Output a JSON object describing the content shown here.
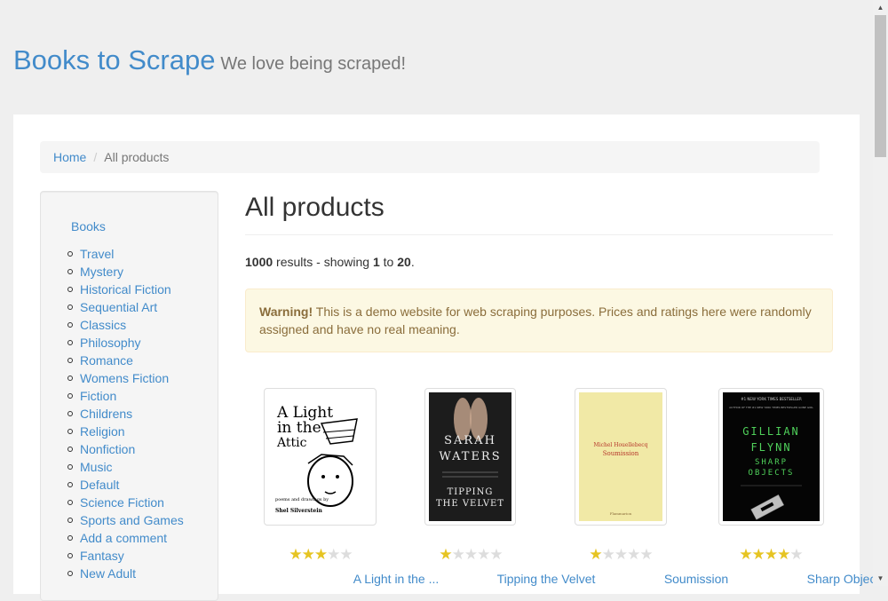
{
  "brand": {
    "title": "Books to Scrape",
    "tagline": "We love being scraped!"
  },
  "breadcrumb": {
    "home": "Home",
    "sep": "/",
    "current": "All products"
  },
  "sidebar": {
    "heading": "Books",
    "items": [
      "Travel",
      "Mystery",
      "Historical Fiction",
      "Sequential Art",
      "Classics",
      "Philosophy",
      "Romance",
      "Womens Fiction",
      "Fiction",
      "Childrens",
      "Religion",
      "Nonfiction",
      "Music",
      "Default",
      "Science Fiction",
      "Sports and Games",
      "Add a comment",
      "Fantasy",
      "New Adult"
    ]
  },
  "main": {
    "title": "All products",
    "results": {
      "total": "1000",
      "mid": " results - showing ",
      "from": "1",
      "to_word": " to ",
      "to": "20",
      "end": "."
    },
    "alert": {
      "strong": "Warning!",
      "text": " This is a demo website for web scraping purposes. Prices and ratings here were randomly assigned and have no real meaning."
    }
  },
  "products": [
    {
      "title": "A Light in the ...",
      "rating": 3,
      "cover_text": [
        "A Light",
        "in the",
        "Attic"
      ],
      "cover_small": "poems and drawings by",
      "cover_author": "Shel Silverstein"
    },
    {
      "title": "Tipping the Velvet",
      "rating": 1,
      "cover_text": [
        "SARAH",
        "WATERS"
      ],
      "cover_sub": [
        "TIPPING",
        "THE VELVET"
      ]
    },
    {
      "title": "Soumission",
      "rating": 1,
      "cover_author": "Michel Houellebecq",
      "cover_title": "Soumission",
      "cover_pub": "Flammarion"
    },
    {
      "title": "Sharp Objects",
      "rating": 4,
      "cover_text": [
        "GILLIAN",
        "FLYNN"
      ],
      "cover_sub": [
        "SHARP",
        "OBJECTS"
      ],
      "cover_top": "#1 NEW YORK TIMES BESTSELLER",
      "cover_top2": "AUTHOR OF THE #1 NEW YORK TIMES BESTSELLER GONE GIRL"
    }
  ],
  "colors": {
    "link": "#428bca",
    "star_on": "#e6c422",
    "star_off": "#dddddd",
    "alert_bg": "#fcf8e3"
  }
}
